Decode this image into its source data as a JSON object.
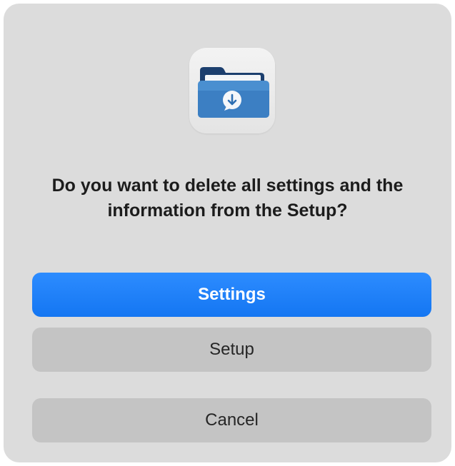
{
  "dialog": {
    "icon": "folder-download-icon",
    "message": "Do you want to delete all settings and the information from the Setup?",
    "buttons": {
      "primary_label": "Settings",
      "setup_label": "Setup",
      "cancel_label": "Cancel"
    }
  },
  "colors": {
    "dialog_background": "#dcdcdc",
    "primary_button": "#1a7cf7",
    "secondary_button": "#c4c4c4",
    "folder_blue": "#3a82c9",
    "folder_dark": "#1c3f6e"
  }
}
